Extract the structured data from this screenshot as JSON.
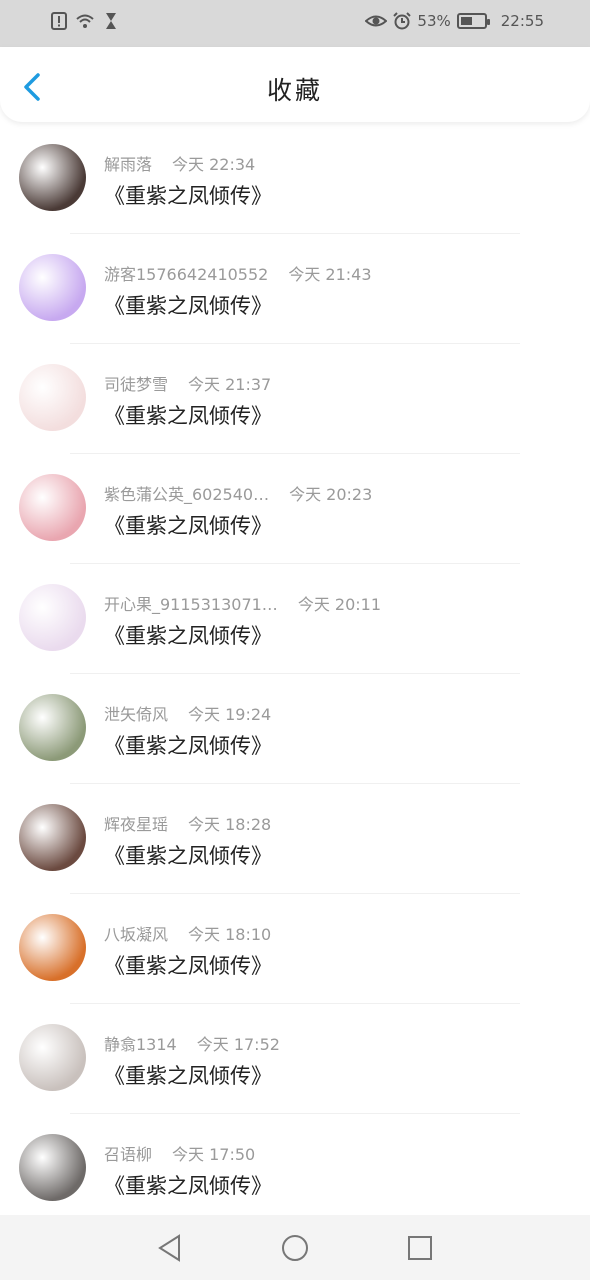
{
  "status_bar": {
    "battery_percent": "53%",
    "battery_level": 0.53,
    "time": "22:55",
    "icons_left": [
      "alert-icon",
      "wifi-icon",
      "hourglass-icon"
    ],
    "icons_right": [
      "eye-icon",
      "alarm-icon",
      "battery-icon"
    ]
  },
  "header": {
    "title": "收藏",
    "accent_color": "#1e9be0"
  },
  "items": [
    {
      "user": "解雨落",
      "time": "今天 22:34",
      "title": "《重紫之凤倾传》",
      "avatar_color": "#4a3a36"
    },
    {
      "user": "游客1576642410552",
      "time": "今天 21:43",
      "title": "《重紫之凤倾传》",
      "avatar_color": "#c7a9f0"
    },
    {
      "user": "司徒梦雪",
      "time": "今天 21:37",
      "title": "《重紫之凤倾传》",
      "avatar_color": "#f3dede"
    },
    {
      "user": "紫色蒲公英_602540…",
      "time": "今天 20:23",
      "title": "《重紫之凤倾传》",
      "avatar_color": "#e9a6b0"
    },
    {
      "user": "开心果_9115313071…",
      "time": "今天 20:11",
      "title": "《重紫之凤倾传》",
      "avatar_color": "#eadbee"
    },
    {
      "user": "泄矢倚风",
      "time": "今天 19:24",
      "title": "《重紫之凤倾传》",
      "avatar_color": "#8c9a78"
    },
    {
      "user": "辉夜星瑶",
      "time": "今天 18:28",
      "title": "《重紫之凤倾传》",
      "avatar_color": "#6b4a40"
    },
    {
      "user": "八坂凝风",
      "time": "今天 18:10",
      "title": "《重紫之凤倾传》",
      "avatar_color": "#d8702a"
    },
    {
      "user": "静翕1314",
      "time": "今天 17:52",
      "title": "《重紫之凤倾传》",
      "avatar_color": "#c9c1bd"
    },
    {
      "user": "召语柳",
      "time": "今天 17:50",
      "title": "《重紫之凤倾传》",
      "avatar_color": "#6e6a68"
    }
  ],
  "nav": {
    "icons": [
      "back-triangle-icon",
      "home-circle-icon",
      "recent-square-icon"
    ]
  }
}
